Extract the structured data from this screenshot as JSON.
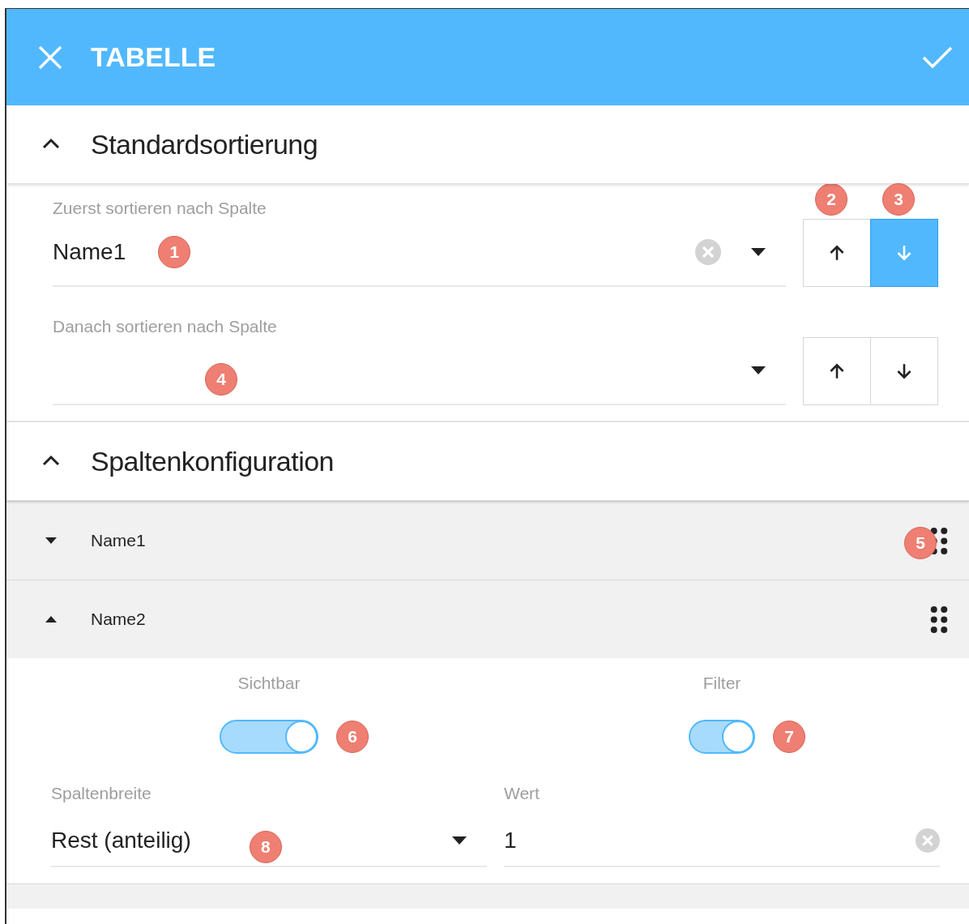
{
  "header": {
    "title": "TABELLE"
  },
  "sections": [
    {
      "kind": "sorting",
      "title": "Standardsortierung",
      "expanded": true,
      "sort_rules": [
        {
          "label": "Zuerst sortieren nach Spalte",
          "value": "Name1",
          "clearable": true,
          "callout": "1",
          "directions": [
            {
              "kind": "up",
              "selected": false,
              "callout": "2"
            },
            {
              "kind": "down",
              "selected": true,
              "callout": "3"
            }
          ]
        },
        {
          "label": "Danach sortieren nach Spalte",
          "clearable": false,
          "callout": "4",
          "directions": [
            {
              "kind": "up",
              "selected": false
            },
            {
              "kind": "down",
              "selected": false
            }
          ]
        }
      ]
    },
    {
      "kind": "columns",
      "title": "Spaltenkonfiguration",
      "expanded": true,
      "columns": [
        {
          "name": "Name1",
          "expanded": false,
          "callout": "5"
        },
        {
          "name": "Name2",
          "expanded": true,
          "settings": {
            "toggles": [
              {
                "label": "Sichtbar",
                "on": true,
                "callout": "6"
              },
              {
                "label": "Filter",
                "on": true,
                "callout": "7"
              }
            ],
            "width_field": {
              "label": "Spaltenbreite",
              "value": "Rest (anteilig)",
              "callout": "8"
            },
            "value_field": {
              "label": "Wert",
              "value": "1",
              "clearable": true
            }
          }
        }
      ]
    }
  ]
}
